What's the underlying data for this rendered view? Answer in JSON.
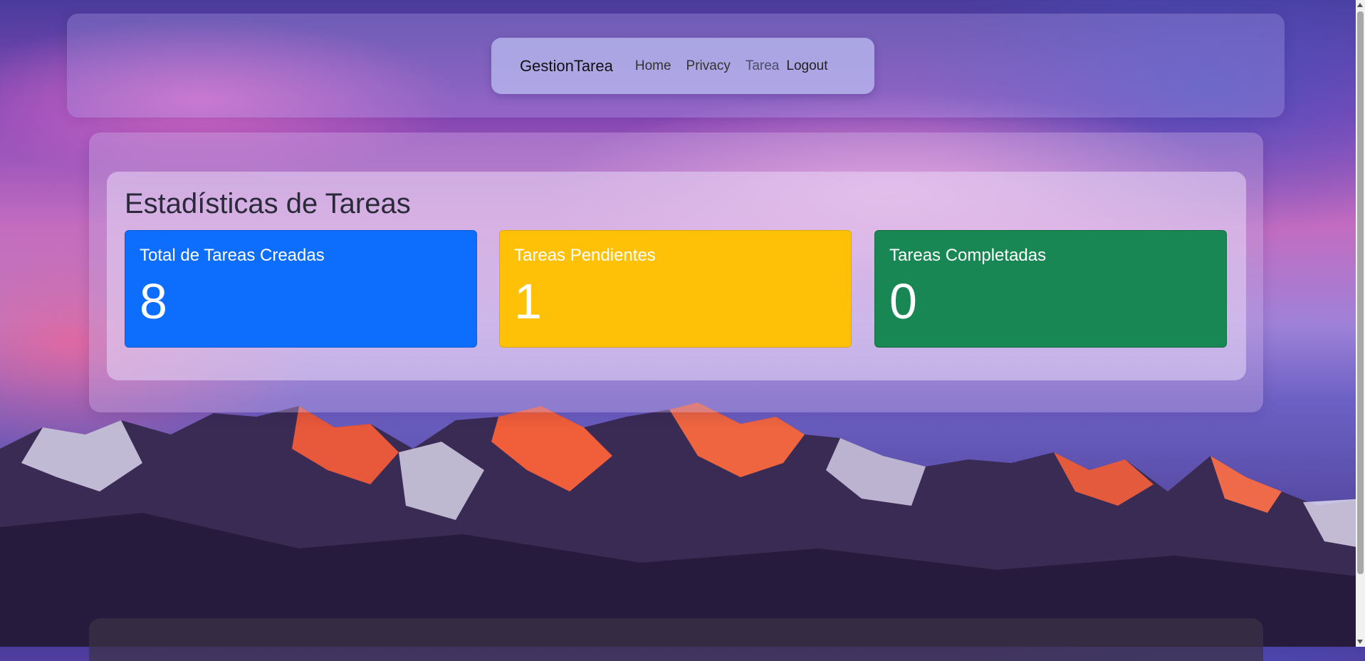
{
  "navbar": {
    "brand": "GestionTarea",
    "links": [
      "Home",
      "Privacy",
      "Tarea",
      "Logout"
    ]
  },
  "stats": {
    "title": "Estadísticas de Tareas",
    "cards": [
      {
        "label": "Total de Tareas Creadas",
        "value": "8",
        "color": "#0d6efd"
      },
      {
        "label": "Tareas Pendientes",
        "value": "1",
        "color": "#ffc107"
      },
      {
        "label": "Tareas Completadas",
        "value": "0",
        "color": "#198754"
      }
    ]
  }
}
